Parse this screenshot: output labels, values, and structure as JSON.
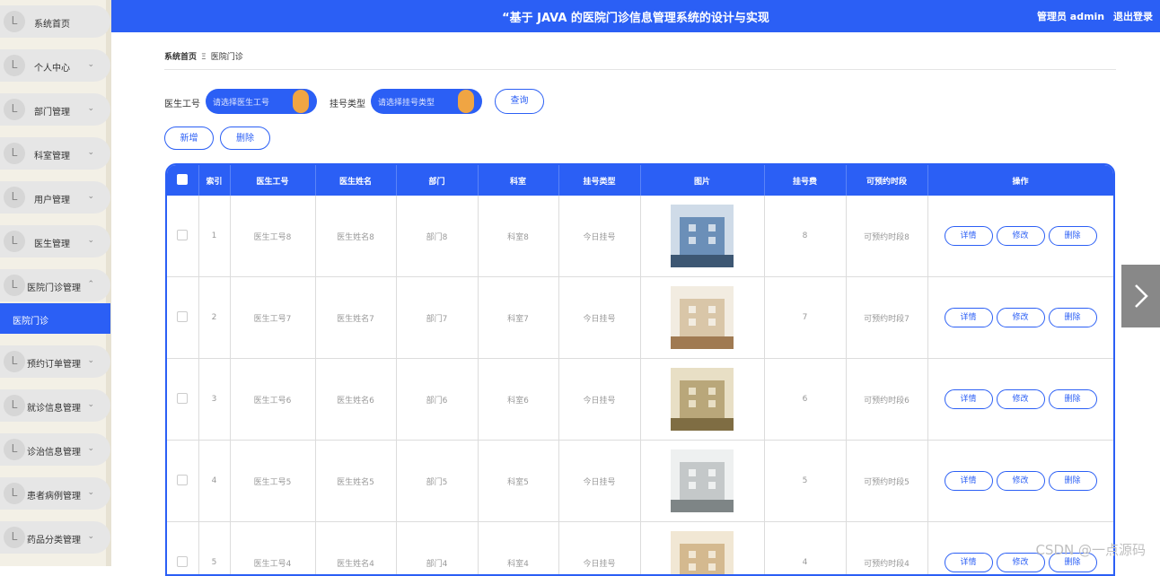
{
  "header": {
    "title": "“基于 JAVA 的医院门诊信息管理系统的设计与实现",
    "user": "管理员 admin",
    "logout": "退出登录"
  },
  "sidebar": {
    "items": [
      {
        "label": "系统首页",
        "chevron": ""
      },
      {
        "label": "个人中心",
        "chevron": "⌄"
      },
      {
        "label": "部门管理",
        "chevron": "⌄"
      },
      {
        "label": "科室管理",
        "chevron": "⌄"
      },
      {
        "label": "用户管理",
        "chevron": "⌄"
      },
      {
        "label": "医生管理",
        "chevron": "⌄"
      },
      {
        "label": "医院门诊管理",
        "chevron": "⌃"
      },
      {
        "label": "医院门诊",
        "chevron": ""
      },
      {
        "label": "预约订单管理",
        "chevron": "⌄"
      },
      {
        "label": "就诊信息管理",
        "chevron": "⌄"
      },
      {
        "label": "诊治信息管理",
        "chevron": "⌄"
      },
      {
        "label": "患者病例管理",
        "chevron": "⌄"
      },
      {
        "label": "药品分类管理",
        "chevron": "⌄"
      }
    ]
  },
  "breadcrumb": {
    "home": "系统首页",
    "sep": "Ξ",
    "current": "医院门诊"
  },
  "search": {
    "doctor_label": "医生工号",
    "doctor_placeholder": "请选择医生工号",
    "type_label": "挂号类型",
    "type_placeholder": "请选择挂号类型",
    "query_button": "查询"
  },
  "actions": {
    "add": "新增",
    "delete": "删除"
  },
  "table": {
    "headers": [
      "索引",
      "医生工号",
      "医生姓名",
      "部门",
      "科室",
      "挂号类型",
      "图片",
      "挂号费",
      "可预约时段",
      "操作"
    ],
    "rows": [
      {
        "index": "1",
        "doctor_no": "医生工号8",
        "doctor_name": "医生姓名8",
        "dept": "部门8",
        "room": "科室8",
        "type": "今日挂号",
        "fee": "8",
        "slot": "可预约时段8"
      },
      {
        "index": "2",
        "doctor_no": "医生工号7",
        "doctor_name": "医生姓名7",
        "dept": "部门7",
        "room": "科室7",
        "type": "今日挂号",
        "fee": "7",
        "slot": "可预约时段7"
      },
      {
        "index": "3",
        "doctor_no": "医生工号6",
        "doctor_name": "医生姓名6",
        "dept": "部门6",
        "room": "科室6",
        "type": "今日挂号",
        "fee": "6",
        "slot": "可预约时段6"
      },
      {
        "index": "4",
        "doctor_no": "医生工号5",
        "doctor_name": "医生姓名5",
        "dept": "部门5",
        "room": "科室5",
        "type": "今日挂号",
        "fee": "5",
        "slot": "可预约时段5"
      },
      {
        "index": "5",
        "doctor_no": "医生工号4",
        "doctor_name": "医生姓名4",
        "dept": "部门4",
        "room": "科室4",
        "type": "今日挂号",
        "fee": "4",
        "slot": "可预约时段4"
      }
    ],
    "row_actions": {
      "detail": "详情",
      "edit": "修改",
      "delete": "删除"
    }
  },
  "watermark": "CSDN @一点源码",
  "colors": {
    "primary": "#2b5ff5",
    "knob": "#f0a543"
  }
}
